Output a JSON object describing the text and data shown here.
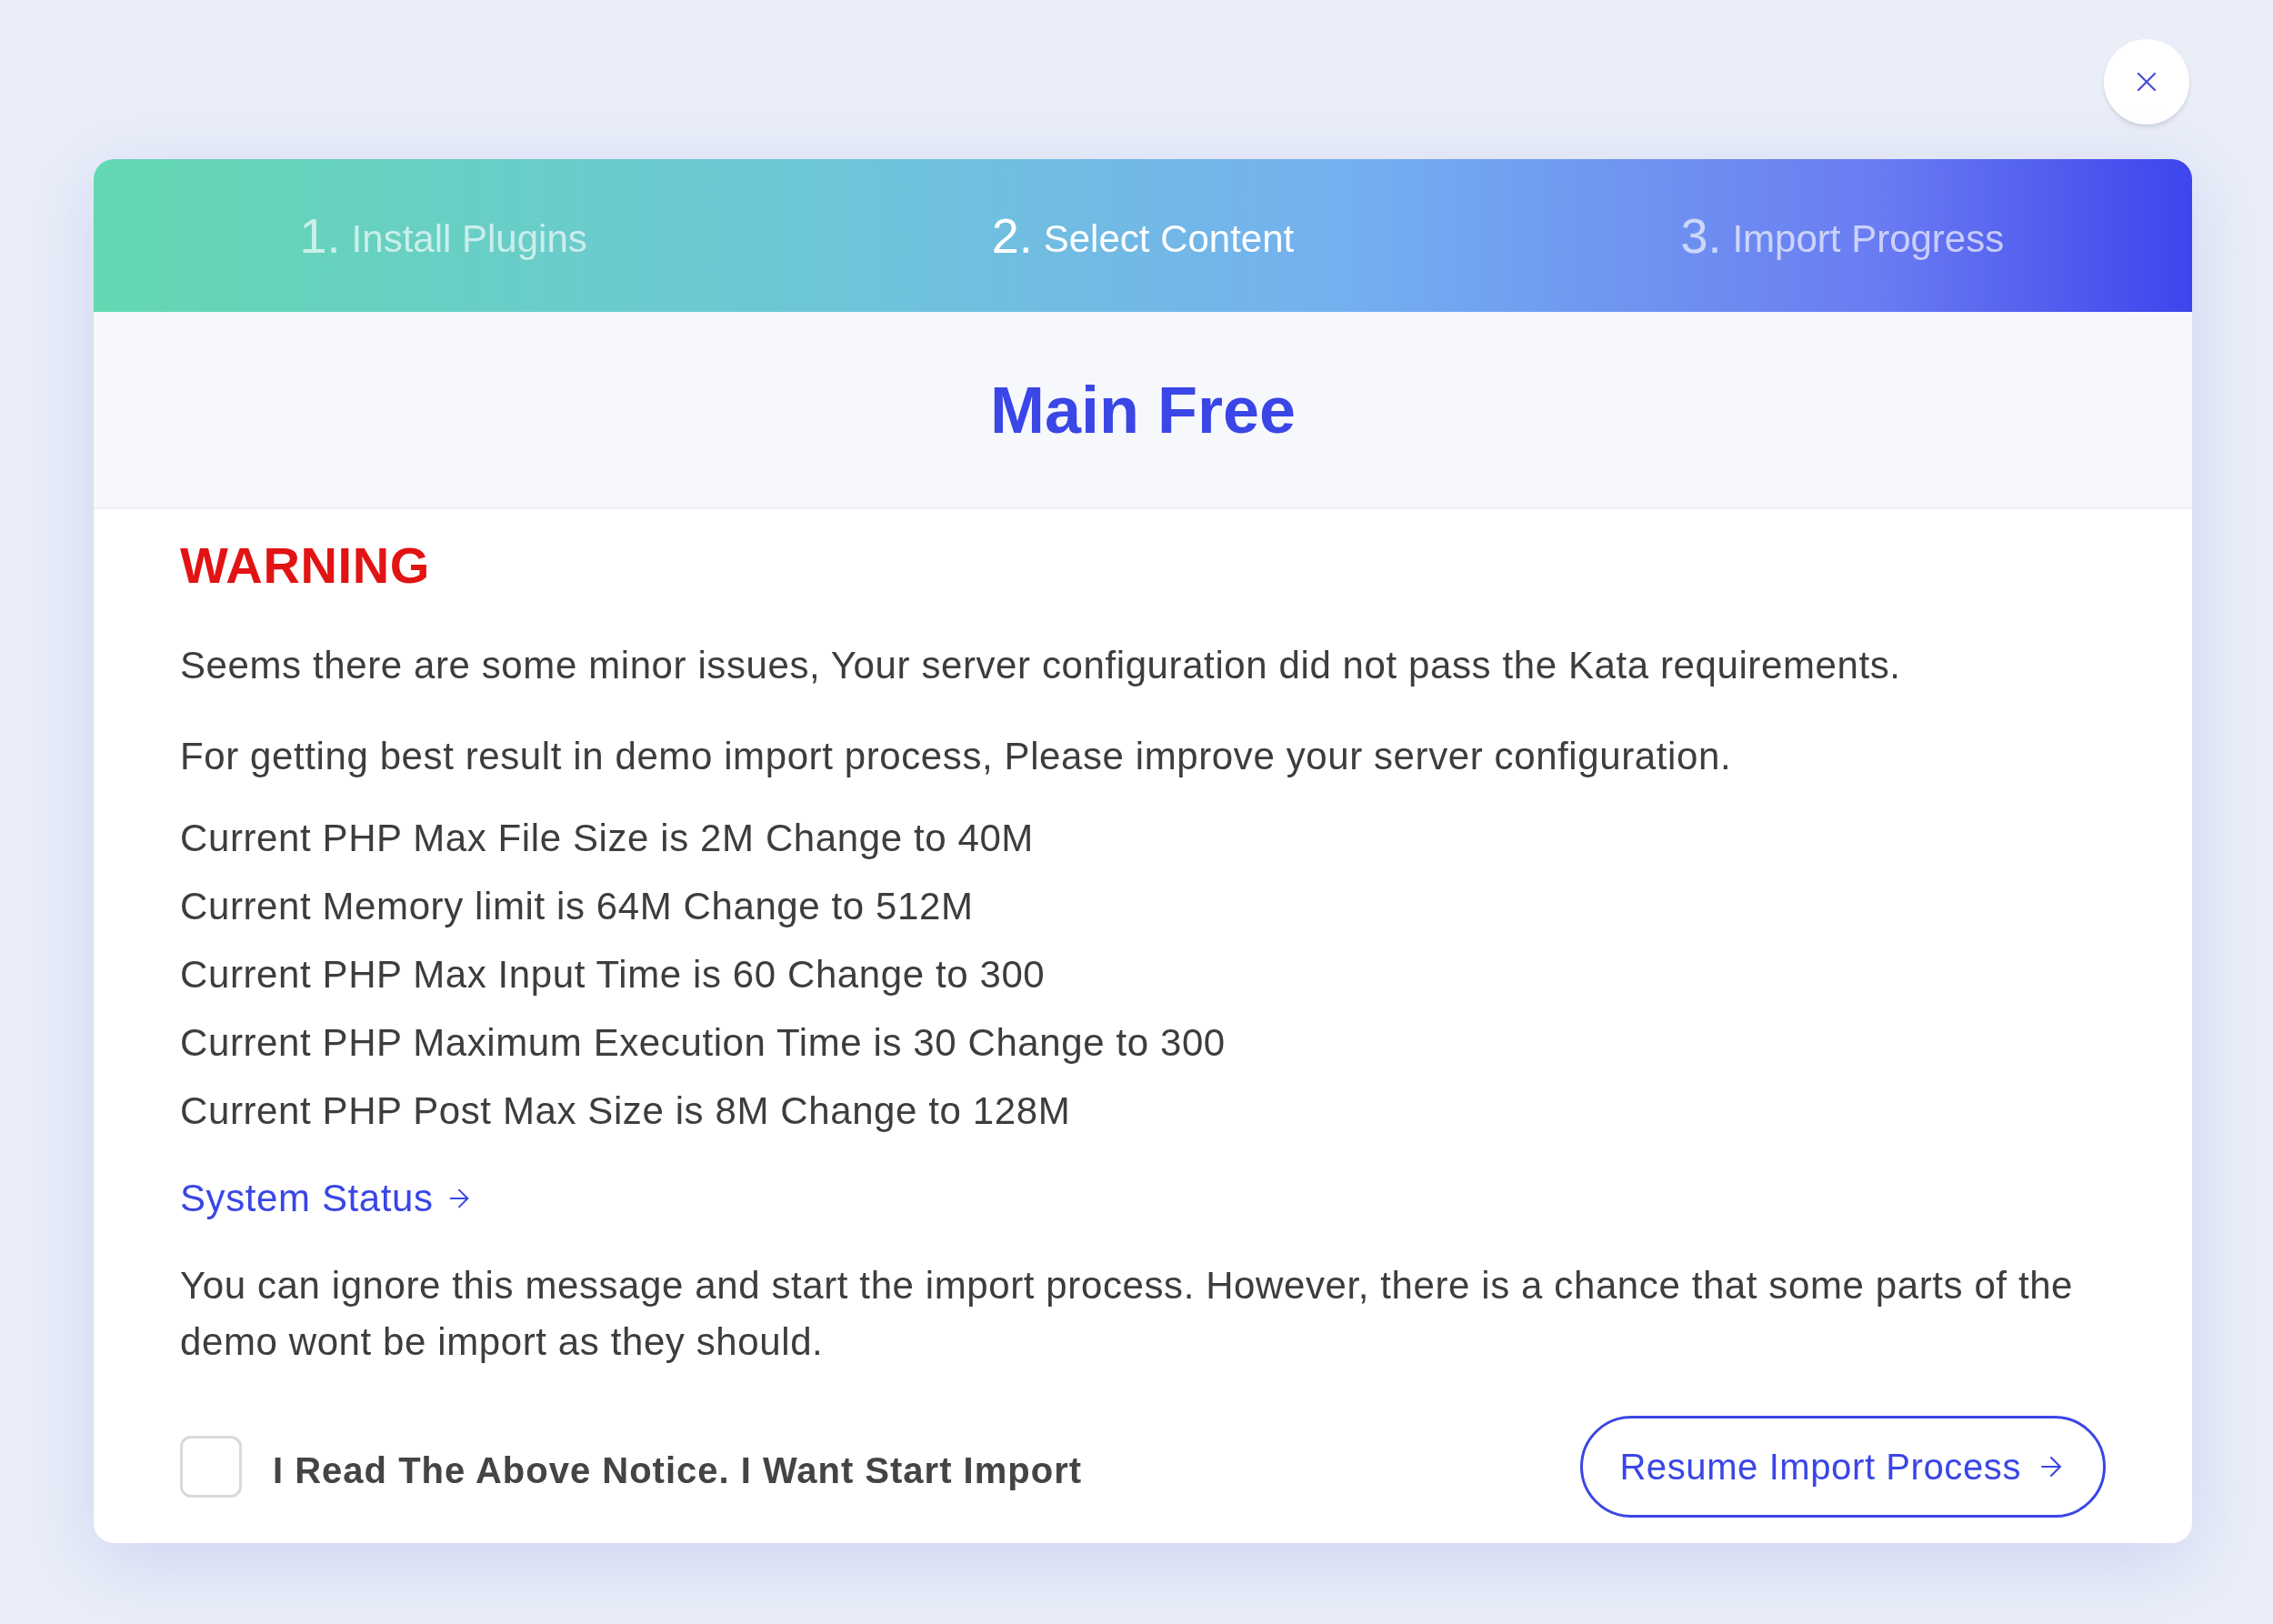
{
  "steps": [
    {
      "number": "1.",
      "label": "Install Plugins",
      "selected": false
    },
    {
      "number": "2.",
      "label": "Select Content",
      "selected": true
    },
    {
      "number": "3.",
      "label": "Import Progress",
      "selected": false
    }
  ],
  "title": "Main Free",
  "warning": {
    "heading": "WARNING",
    "paragraphs": [
      "Seems there are some minor issues, Your server configuration did not pass the Kata requirements.",
      "For getting best result in demo import process, Please improve your server configuration."
    ],
    "requirements": [
      "Current PHP Max File Size is 2M Change to 40M",
      "Current Memory limit is 64M Change to 512M",
      "Current PHP Max Input Time is 60 Change to 300",
      "Current PHP Maximum Execution Time is 30 Change to 300",
      "Current PHP Post Max Size is 8M Change to 128M"
    ],
    "link": "System Status",
    "note": "You can ignore this message and start the import process. However, there is a chance that some parts of the demo wont be import as they should."
  },
  "consent": {
    "label": "I Read The Above Notice. I Want Start Import",
    "checked": false
  },
  "resume_button": "Resume Import Process"
}
